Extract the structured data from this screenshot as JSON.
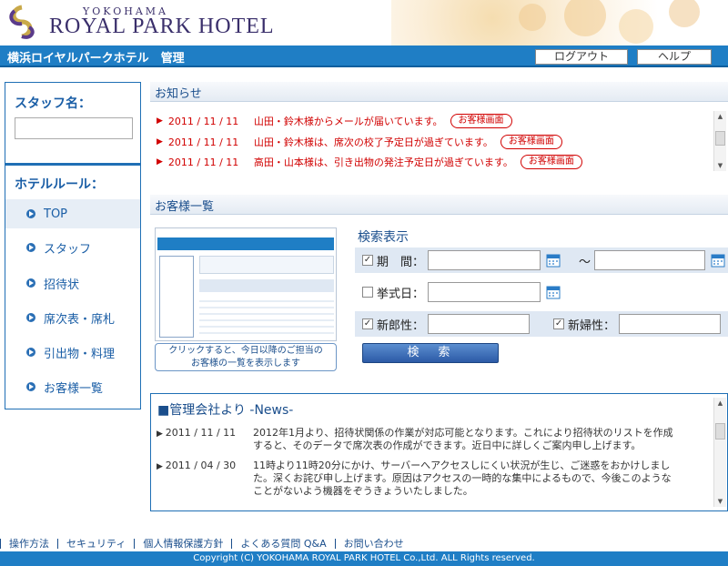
{
  "header": {
    "logo_sub": "YOKOHAMA",
    "logo_main": "ROYAL PARK HOTEL",
    "bar_title": "横浜ロイヤルパークホテル　管理",
    "logout": "ログアウト",
    "help": "ヘルプ"
  },
  "sidebar": {
    "staff_label": "スタッフ名：",
    "rules_label": "ホテルルール：",
    "items": [
      "TOP",
      "スタッフ",
      "招待状",
      "席次表・席札",
      "引出物・料理",
      "お客様一覧"
    ]
  },
  "notices": {
    "title": "お知らせ",
    "items": [
      {
        "date": "2011 / 11 / 11",
        "text": "山田・鈴木様からメールが届いています。",
        "button": "お客様画面"
      },
      {
        "date": "2011 / 11 / 11",
        "text": "山田・鈴木様は、席次の校了予定日が過ぎています。",
        "button": "お客様画面"
      },
      {
        "date": "2011 / 11 / 11",
        "text": "高田・山本様は、引き出物の発注予定日が過ぎています。",
        "button": "お客様画面"
      }
    ]
  },
  "guests": {
    "title": "お客様一覧",
    "thumb_caption": [
      "クリックすると、今日以降のご担当の",
      "お客様の一覧を表示します"
    ]
  },
  "search": {
    "title": "検索表示",
    "period_label": "期　間：",
    "tilde": "～",
    "wedding_label": "挙式日：",
    "groom_label": "新郎性：",
    "bride_label": "新婦性：",
    "period_checked": true,
    "wedding_checked": false,
    "groom_checked": true,
    "bride_checked": true,
    "button": "検　索"
  },
  "news": {
    "title": "■管理会社より -News-",
    "items": [
      {
        "date": "2011 / 11 / 11",
        "text": "2012年1月より、招待状関係の作業が対応可能となります。これにより招待状のリストを作成すると、そのデータで席次表の作成ができます。近日中に詳しくご案内申し上げます。"
      },
      {
        "date": "2011 / 04 / 30",
        "text": "11時より11時20分にかけ、サーバーへアクセスしにくい状況が生じ、ご迷惑をおかけしました。深くお詫び申し上げます。原因はアクセスの一時的な集中によるもので、今後このようなことがないよう機器をぞうきょういたしました。"
      }
    ]
  },
  "footer": {
    "links": [
      "操作方法",
      "セキュリティ",
      "個人情報保護方針",
      "よくある質問 Q&A",
      "お問い合わせ"
    ],
    "copyright": "Copyright (C) YOKOHAMA ROYAL PARK HOTEL Co.,Ltd. ALL Rights reserved."
  },
  "colors": {
    "brand_blue": "#1f7ec5",
    "alert_red": "#d10000",
    "logo_purple": "#3a2f6b"
  }
}
